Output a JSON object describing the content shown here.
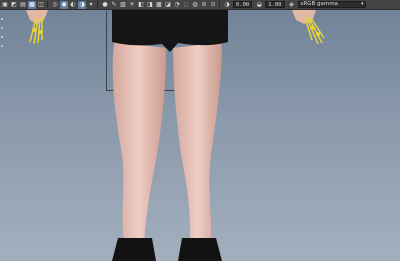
{
  "toolbar": {
    "exposure": "0.00",
    "gamma": "1.00",
    "color_space": "sRGB gamma",
    "icons": [
      "camera-attributes-icon",
      "bookmark-icon",
      "image-plane-icon",
      "grid-icon",
      "film-gate-icon",
      "resolution-gate-icon",
      "gate-mask-icon",
      "field-chart-icon",
      "safe-action-icon",
      "wireframe-icon",
      "smooth-shade-icon",
      "default-material-icon",
      "textured-icon",
      "lighting-icon",
      "shadows-icon",
      "screen-space-ao-icon",
      "motion-blur-icon",
      "anti-aliasing-icon",
      "depth-of-field-icon",
      "isolate-select-icon",
      "xray-icon",
      "xray-joints-icon",
      "backface-icon",
      "exposure-icon",
      "gamma-icon",
      "color-management-icon"
    ]
  },
  "colors": {
    "toolbar_bg": "#444444",
    "active_button": "#5e7fa3",
    "viewport_top": "#6f8196",
    "viewport_bottom": "#a3afbd",
    "skin": "#e8c3b8",
    "shorts": "#151515",
    "joint_highlight": "#e6d23c"
  }
}
